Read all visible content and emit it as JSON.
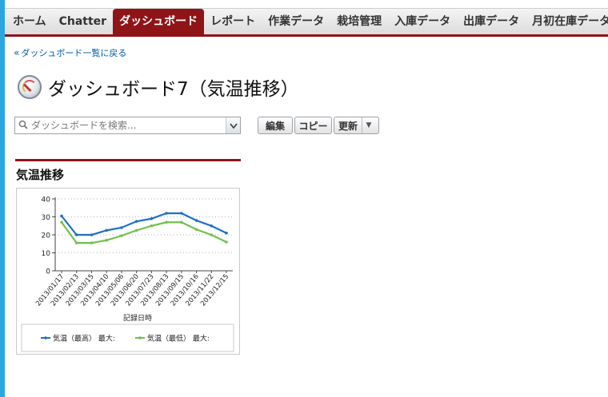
{
  "tabs": [
    "ホーム",
    "Chatter",
    "ダッシュボード",
    "レポート",
    "作業データ",
    "栽培管理",
    "入庫データ",
    "出庫データ",
    "月初在庫データ"
  ],
  "active_tab": "ダッシュボード",
  "back_link": "ダッシュボード一覧に戻る",
  "page_title": "ダッシュボード7（気温推移）",
  "search": {
    "placeholder": "ダッシュボードを検索..."
  },
  "buttons": {
    "edit": "編集",
    "copy": "コピー",
    "refresh": "更新"
  },
  "component": {
    "title": "気温推移"
  },
  "colors": {
    "tab_accent": "#8f1417",
    "series_high": "#1f6fc5",
    "series_low": "#72c04c",
    "link": "#015ba7"
  },
  "icons": {
    "dashboard": "dashboard-gauge-icon",
    "search": "search-icon",
    "dropdown": "chevron-down-icon"
  },
  "chart_data": {
    "type": "line",
    "xlabel": "記録日時",
    "ylabel": "",
    "ylim": [
      0,
      40
    ],
    "yticks": [
      0,
      10,
      20,
      30,
      40
    ],
    "grid": true,
    "legend_position": "bottom",
    "x": [
      "2013/01/17",
      "2013/02/13",
      "2013/03/15",
      "2013/04/10",
      "2013/05/06",
      "2013/06/20",
      "2013/07/23",
      "2013/08/13",
      "2013/09/15",
      "2013/10/16",
      "2013/11/22",
      "2013/12/15"
    ],
    "series": [
      {
        "name": "気温（最高） 最大:",
        "color": "#1f6fc5",
        "values": [
          30.5,
          20,
          20,
          22.5,
          24,
          27.5,
          29,
          32,
          32,
          28,
          25,
          21
        ]
      },
      {
        "name": "気温（最低） 最大:",
        "color": "#72c04c",
        "values": [
          27,
          15.5,
          15.5,
          17,
          19.5,
          22.5,
          25,
          27,
          27,
          23,
          20,
          16
        ]
      }
    ]
  }
}
